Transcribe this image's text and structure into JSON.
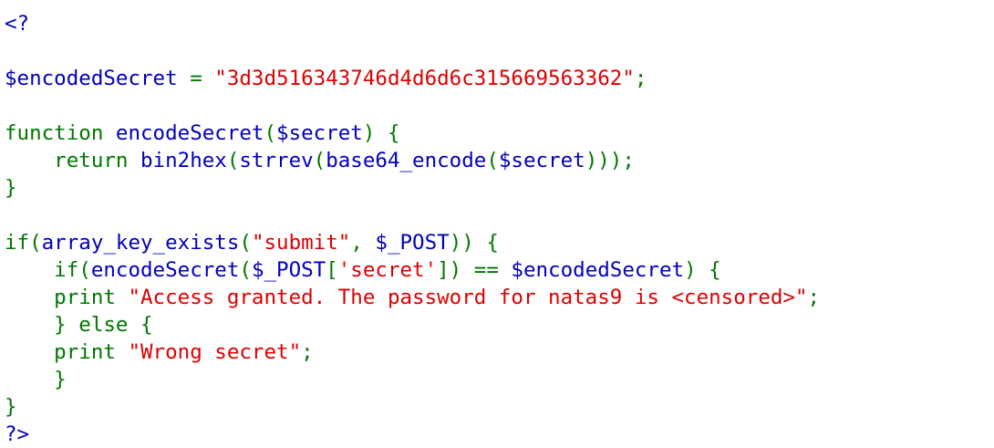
{
  "lines": [
    [
      {
        "t": "<?",
        "c": "var"
      }
    ],
    [],
    [
      {
        "t": "$encodedSecret ",
        "c": "var"
      },
      {
        "t": "= ",
        "c": "kw"
      },
      {
        "t": "\"3d3d516343746d4d6d6c315669563362\"",
        "c": "str"
      },
      {
        "t": ";",
        "c": "kw"
      }
    ],
    [],
    [
      {
        "t": "function ",
        "c": "kw"
      },
      {
        "t": "encodeSecret",
        "c": "var"
      },
      {
        "t": "(",
        "c": "kw"
      },
      {
        "t": "$secret",
        "c": "var"
      },
      {
        "t": ") {",
        "c": "kw"
      }
    ],
    [
      {
        "t": "    return ",
        "c": "kw"
      },
      {
        "t": "bin2hex",
        "c": "var"
      },
      {
        "t": "(",
        "c": "kw"
      },
      {
        "t": "strrev",
        "c": "var"
      },
      {
        "t": "(",
        "c": "kw"
      },
      {
        "t": "base64_encode",
        "c": "var"
      },
      {
        "t": "(",
        "c": "kw"
      },
      {
        "t": "$secret",
        "c": "var"
      },
      {
        "t": ")));",
        "c": "kw"
      }
    ],
    [
      {
        "t": "}",
        "c": "kw"
      }
    ],
    [],
    [
      {
        "t": "if(",
        "c": "kw"
      },
      {
        "t": "array_key_exists",
        "c": "var"
      },
      {
        "t": "(",
        "c": "kw"
      },
      {
        "t": "\"submit\"",
        "c": "str"
      },
      {
        "t": ", ",
        "c": "kw"
      },
      {
        "t": "$_POST",
        "c": "var"
      },
      {
        "t": ")) {",
        "c": "kw"
      }
    ],
    [
      {
        "t": "    if(",
        "c": "kw"
      },
      {
        "t": "encodeSecret",
        "c": "var"
      },
      {
        "t": "(",
        "c": "kw"
      },
      {
        "t": "$_POST",
        "c": "var"
      },
      {
        "t": "[",
        "c": "kw"
      },
      {
        "t": "'secret'",
        "c": "str"
      },
      {
        "t": "]) == ",
        "c": "kw"
      },
      {
        "t": "$encodedSecret",
        "c": "var"
      },
      {
        "t": ") {",
        "c": "kw"
      }
    ],
    [
      {
        "t": "    print ",
        "c": "kw"
      },
      {
        "t": "\"Access granted. The password for natas9 is <censored>\"",
        "c": "str"
      },
      {
        "t": ";",
        "c": "kw"
      }
    ],
    [
      {
        "t": "    } else {",
        "c": "kw"
      }
    ],
    [
      {
        "t": "    print ",
        "c": "kw"
      },
      {
        "t": "\"Wrong secret\"",
        "c": "str"
      },
      {
        "t": ";",
        "c": "kw"
      }
    ],
    [
      {
        "t": "    }",
        "c": "kw"
      }
    ],
    [
      {
        "t": "}",
        "c": "kw"
      }
    ],
    [
      {
        "t": "?>",
        "c": "var"
      }
    ]
  ],
  "colors": {
    "keyword": "#007700",
    "string": "#dd0000",
    "default": "#0000bb",
    "background": "#ffffff"
  }
}
